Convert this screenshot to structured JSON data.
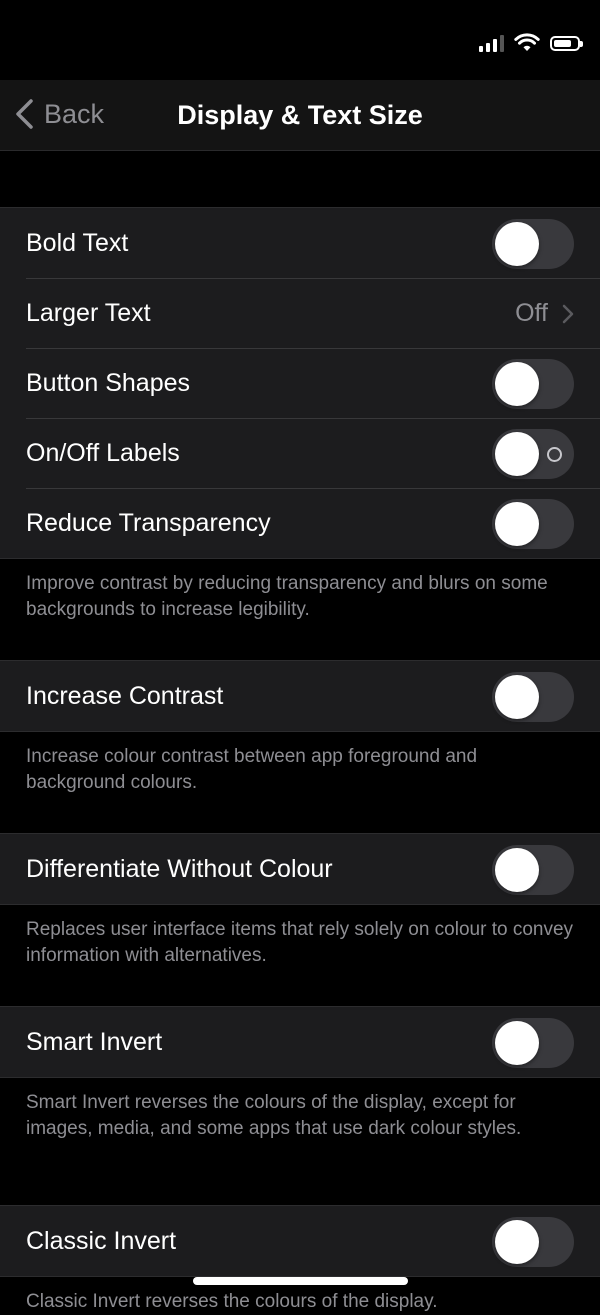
{
  "nav": {
    "back_label": "Back",
    "title": "Display & Text Size"
  },
  "status": {
    "battery_percent": 70
  },
  "group1": {
    "bold_text": {
      "label": "Bold Text",
      "on": false
    },
    "larger_text": {
      "label": "Larger Text",
      "value": "Off"
    },
    "button_shapes": {
      "label": "Button Shapes",
      "on": false
    },
    "on_off_labels": {
      "label": "On/Off Labels",
      "on": false
    },
    "reduce_transparency": {
      "label": "Reduce Transparency",
      "on": false
    },
    "footer": "Improve contrast by reducing transparency and blurs on some backgrounds to increase legibility."
  },
  "group2": {
    "increase_contrast": {
      "label": "Increase Contrast",
      "on": false
    },
    "footer": "Increase colour contrast between app foreground and background colours."
  },
  "group3": {
    "differentiate": {
      "label": "Differentiate Without Colour",
      "on": false
    },
    "footer": "Replaces user interface items that rely solely on colour to convey information with alternatives."
  },
  "group4": {
    "smart_invert": {
      "label": "Smart Invert",
      "on": false
    },
    "footer": "Smart Invert reverses the colours of the display, except for images, media, and some apps that use dark colour styles."
  },
  "group5": {
    "classic_invert": {
      "label": "Classic Invert",
      "on": false
    },
    "footer": "Classic Invert reverses the colours of the display."
  },
  "colors": {
    "background": "#000000",
    "cell": "#1c1c1e",
    "toggle_off": "#39393d",
    "secondary_text": "#8e8e93"
  }
}
